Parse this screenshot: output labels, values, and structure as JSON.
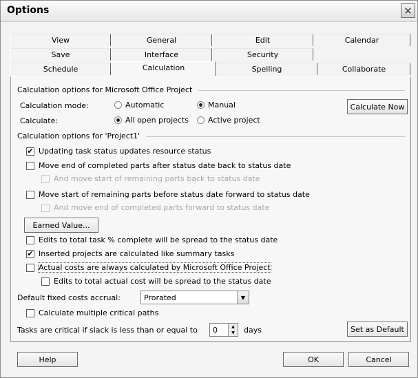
{
  "window": {
    "title": "Options"
  },
  "tabs": {
    "row1": [
      "View",
      "General",
      "Edit",
      "Calendar"
    ],
    "row2": [
      "Save",
      "Interface",
      "Security"
    ],
    "row3": [
      "Schedule",
      "Calculation",
      "Spelling",
      "Collaborate"
    ],
    "active": "Calculation"
  },
  "calc_options": {
    "header": "Calculation options for Microsoft Office Project",
    "mode_label": "Calculation mode:",
    "mode_automatic": "Automatic",
    "mode_manual": "Manual",
    "mode_selected": "Manual",
    "calculate_label": "Calculate:",
    "calc_all": "All open projects",
    "calc_active": "Active project",
    "calc_selected": "All open projects",
    "calculate_now_button": "Calculate Now"
  },
  "project_options": {
    "header": "Calculation options for 'Project1'",
    "updating_task_status": "Updating task status updates resource status",
    "move_end_completed": "Move end of completed parts after status date back to status date",
    "move_start_remaining_back": "And move start of remaining parts back to status date",
    "move_start_remaining": "Move start of remaining parts before status date forward to status date",
    "move_end_completed_forward": "And move end of completed parts forward to status date",
    "earned_value_button": "Earned Value...",
    "edits_total_task": "Edits to total task % complete will be spread to the status date",
    "inserted_projects": "Inserted projects are calculated like summary tasks",
    "actual_costs": "Actual costs are always calculated by Microsoft Office Project",
    "edits_total_actual_cost": "Edits to total actual cost will be spread to the status date",
    "fixed_costs_label": "Default fixed costs accrual:",
    "fixed_costs_value": "Prorated",
    "multiple_critical": "Calculate multiple critical paths",
    "critical_prefix": "Tasks are critical if slack is less than or equal to",
    "slack_value": "0",
    "critical_suffix": "days",
    "set_default_button": "Set as Default"
  },
  "checks": {
    "updating_task_status": true,
    "move_end_completed": false,
    "move_start_remaining_back": false,
    "move_start_remaining": false,
    "move_end_completed_forward": false,
    "edits_total_task": false,
    "inserted_projects": true,
    "actual_costs": false,
    "edits_total_actual_cost": false,
    "multiple_critical": false
  },
  "footer": {
    "help": "Help",
    "ok": "OK",
    "cancel": "Cancel"
  },
  "icons": {
    "close": "close-icon",
    "check": "check-icon",
    "dropdown": "chevron-down-icon",
    "spin_up": "spin-up-icon",
    "spin_down": "spin-down-icon"
  }
}
